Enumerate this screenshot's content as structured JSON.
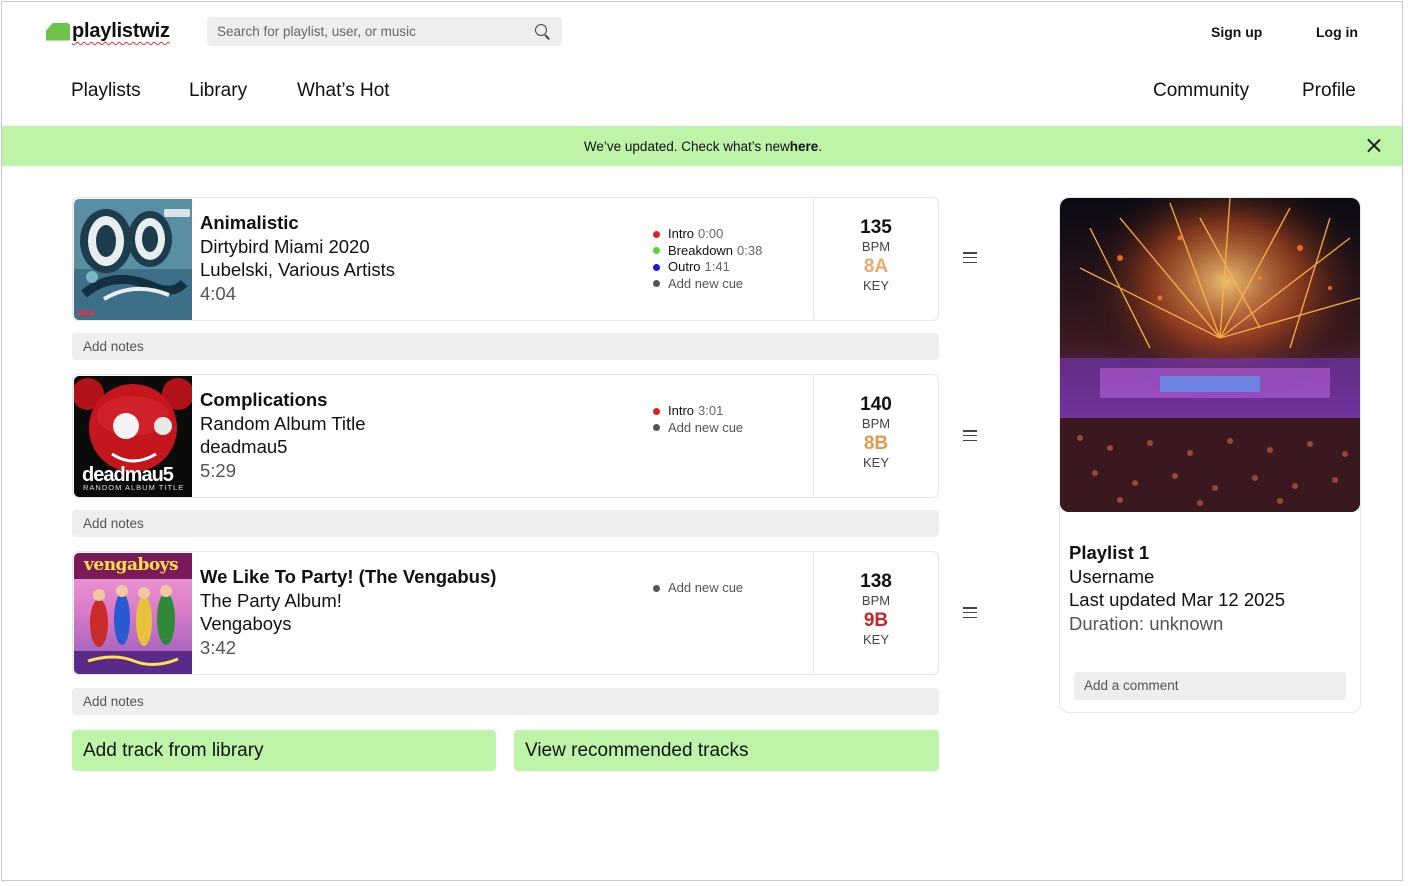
{
  "header": {
    "logo_text": "playlistwiz",
    "search_placeholder": "Search for playlist, user, or music",
    "signup": "Sign up",
    "login": "Log in"
  },
  "nav": {
    "playlists": "Playlists",
    "library": "Library",
    "whats_hot": "What’s Hot",
    "community": "Community",
    "profile": "Profile"
  },
  "banner": {
    "text": "We’ve updated. Check what’s new ",
    "link": "here",
    "end": "."
  },
  "tracks": [
    {
      "title": "Animalistic",
      "album": "Dirtybird Miami 2020",
      "artist": "Lubelski, Various Artists",
      "duration": "4:04",
      "cues": [
        {
          "name": "Intro",
          "time": "0:00",
          "color": "#e02020"
        },
        {
          "name": "Breakdown",
          "time": "0:38",
          "color": "#5ad23c"
        },
        {
          "name": "Outro",
          "time": "1:41",
          "color": "#1020d0"
        }
      ],
      "add_cue": "Add new cue",
      "bpm": "135",
      "bpm_label": "BPM",
      "key": "8A",
      "key_color": "#f0a868",
      "key_label": "KEY",
      "notes_placeholder": "Add notes"
    },
    {
      "title": "Complications",
      "album": "Random Album Title",
      "artist": "deadmau5",
      "duration": "5:29",
      "cues": [
        {
          "name": "Intro",
          "time": "3:01",
          "color": "#e02020"
        }
      ],
      "add_cue": "Add new cue",
      "bpm": "140",
      "bpm_label": "BPM",
      "key": "8B",
      "key_color": "#e09a50",
      "key_label": "KEY",
      "notes_placeholder": "Add notes",
      "cover_text": "deadmau5",
      "cover_subtext": "RANDOM ALBUM TITLE"
    },
    {
      "title": "We Like To Party! (The Vengabus)",
      "album": "The Party Album!",
      "artist": "Vengaboys",
      "duration": "3:42",
      "cues": [],
      "add_cue": "Add new cue",
      "bpm": "138",
      "bpm_label": "BPM",
      "key": "9B",
      "key_color": "#c62828",
      "key_label": "KEY",
      "notes_placeholder": "Add notes",
      "cover_text": "vengaboys"
    }
  ],
  "actions": {
    "add_track": "Add track from library",
    "recommended": "View recommended tracks"
  },
  "playlist": {
    "title": "Playlist 1",
    "username": "Username",
    "updated": "Last updated Mar 12 2025",
    "duration": "Duration: unknown",
    "comment_placeholder": "Add a comment"
  },
  "colors": {
    "accent_green": "#bdf4a8",
    "logo_green": "#6cc24a"
  }
}
